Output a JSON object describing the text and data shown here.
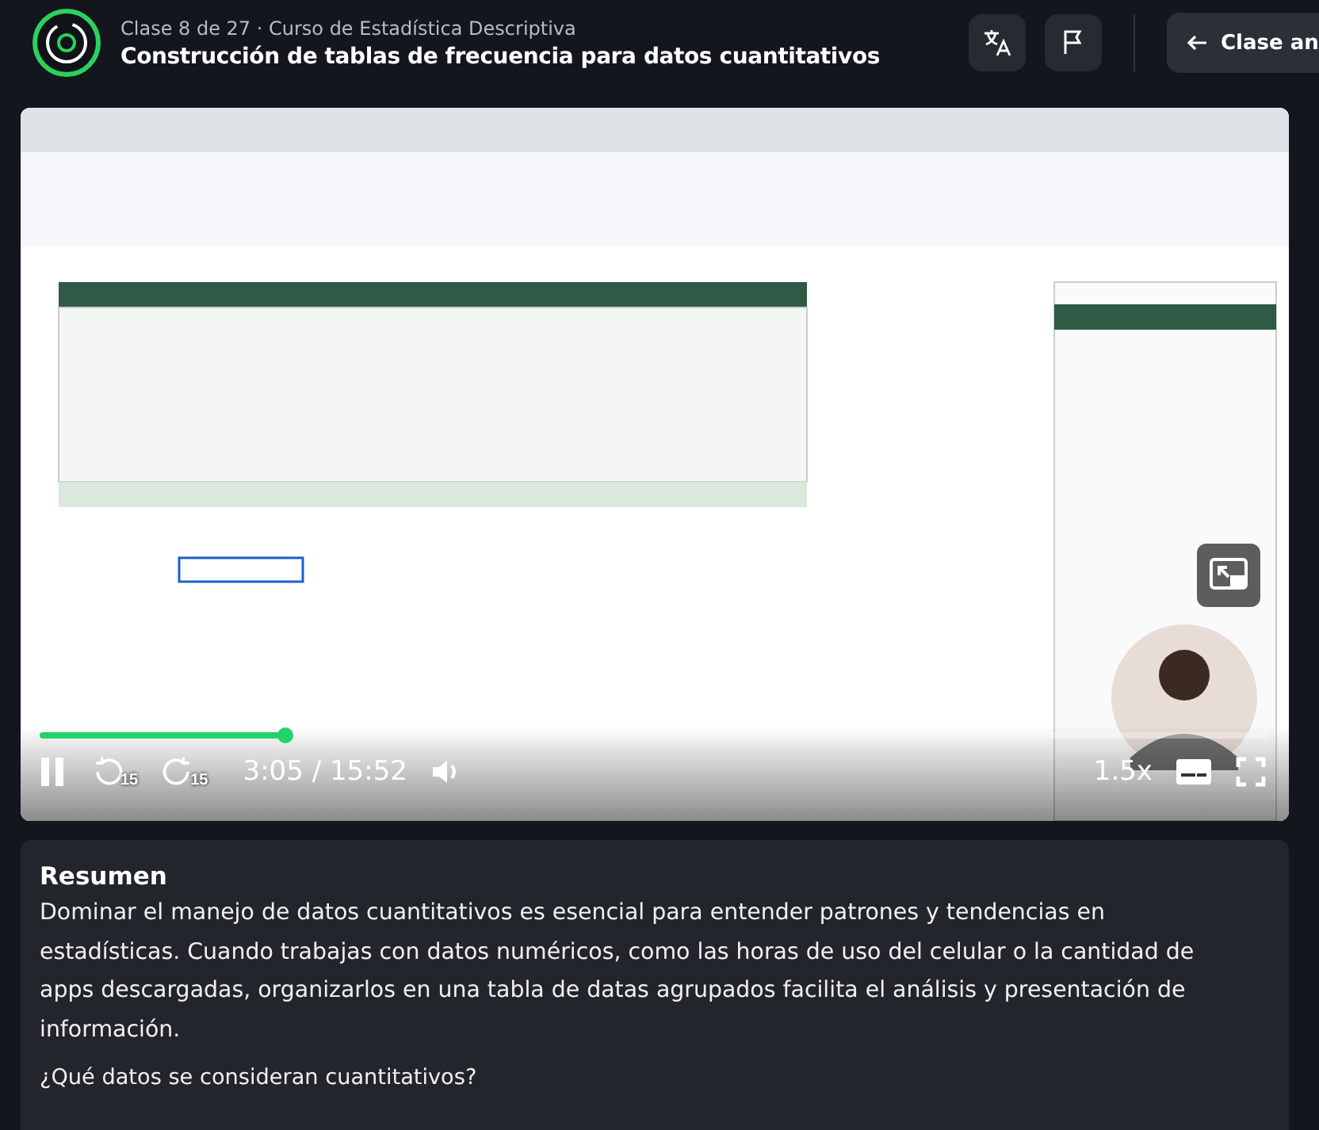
{
  "header": {
    "course_line": "Clase 8 de 27 · Curso de Estadística Descriptiva",
    "title": "Construcción de tablas de frecuencia para datos cuantitativos",
    "prev_button": "Clase an"
  },
  "video": {
    "playing": true,
    "progress": {
      "level": 0.2
    },
    "skip_back": "15",
    "skip_forward": "15",
    "time": "3:05 / 15:52",
    "speed": "1.5x"
  },
  "summary": {
    "heading": "Resumen",
    "paragraph": "Dominar el manejo de datos cuantitativos es esencial para entender patrones y tendencias en estadísticas. Cuando trabajas con datos numéricos, como las horas de uso del celular o la cantidad de apps descargadas, organizarlos en una tabla de datas agrupados facilita el análisis y presentación de información.",
    "question": "¿Qué datos se consideran cuantitativos?"
  }
}
